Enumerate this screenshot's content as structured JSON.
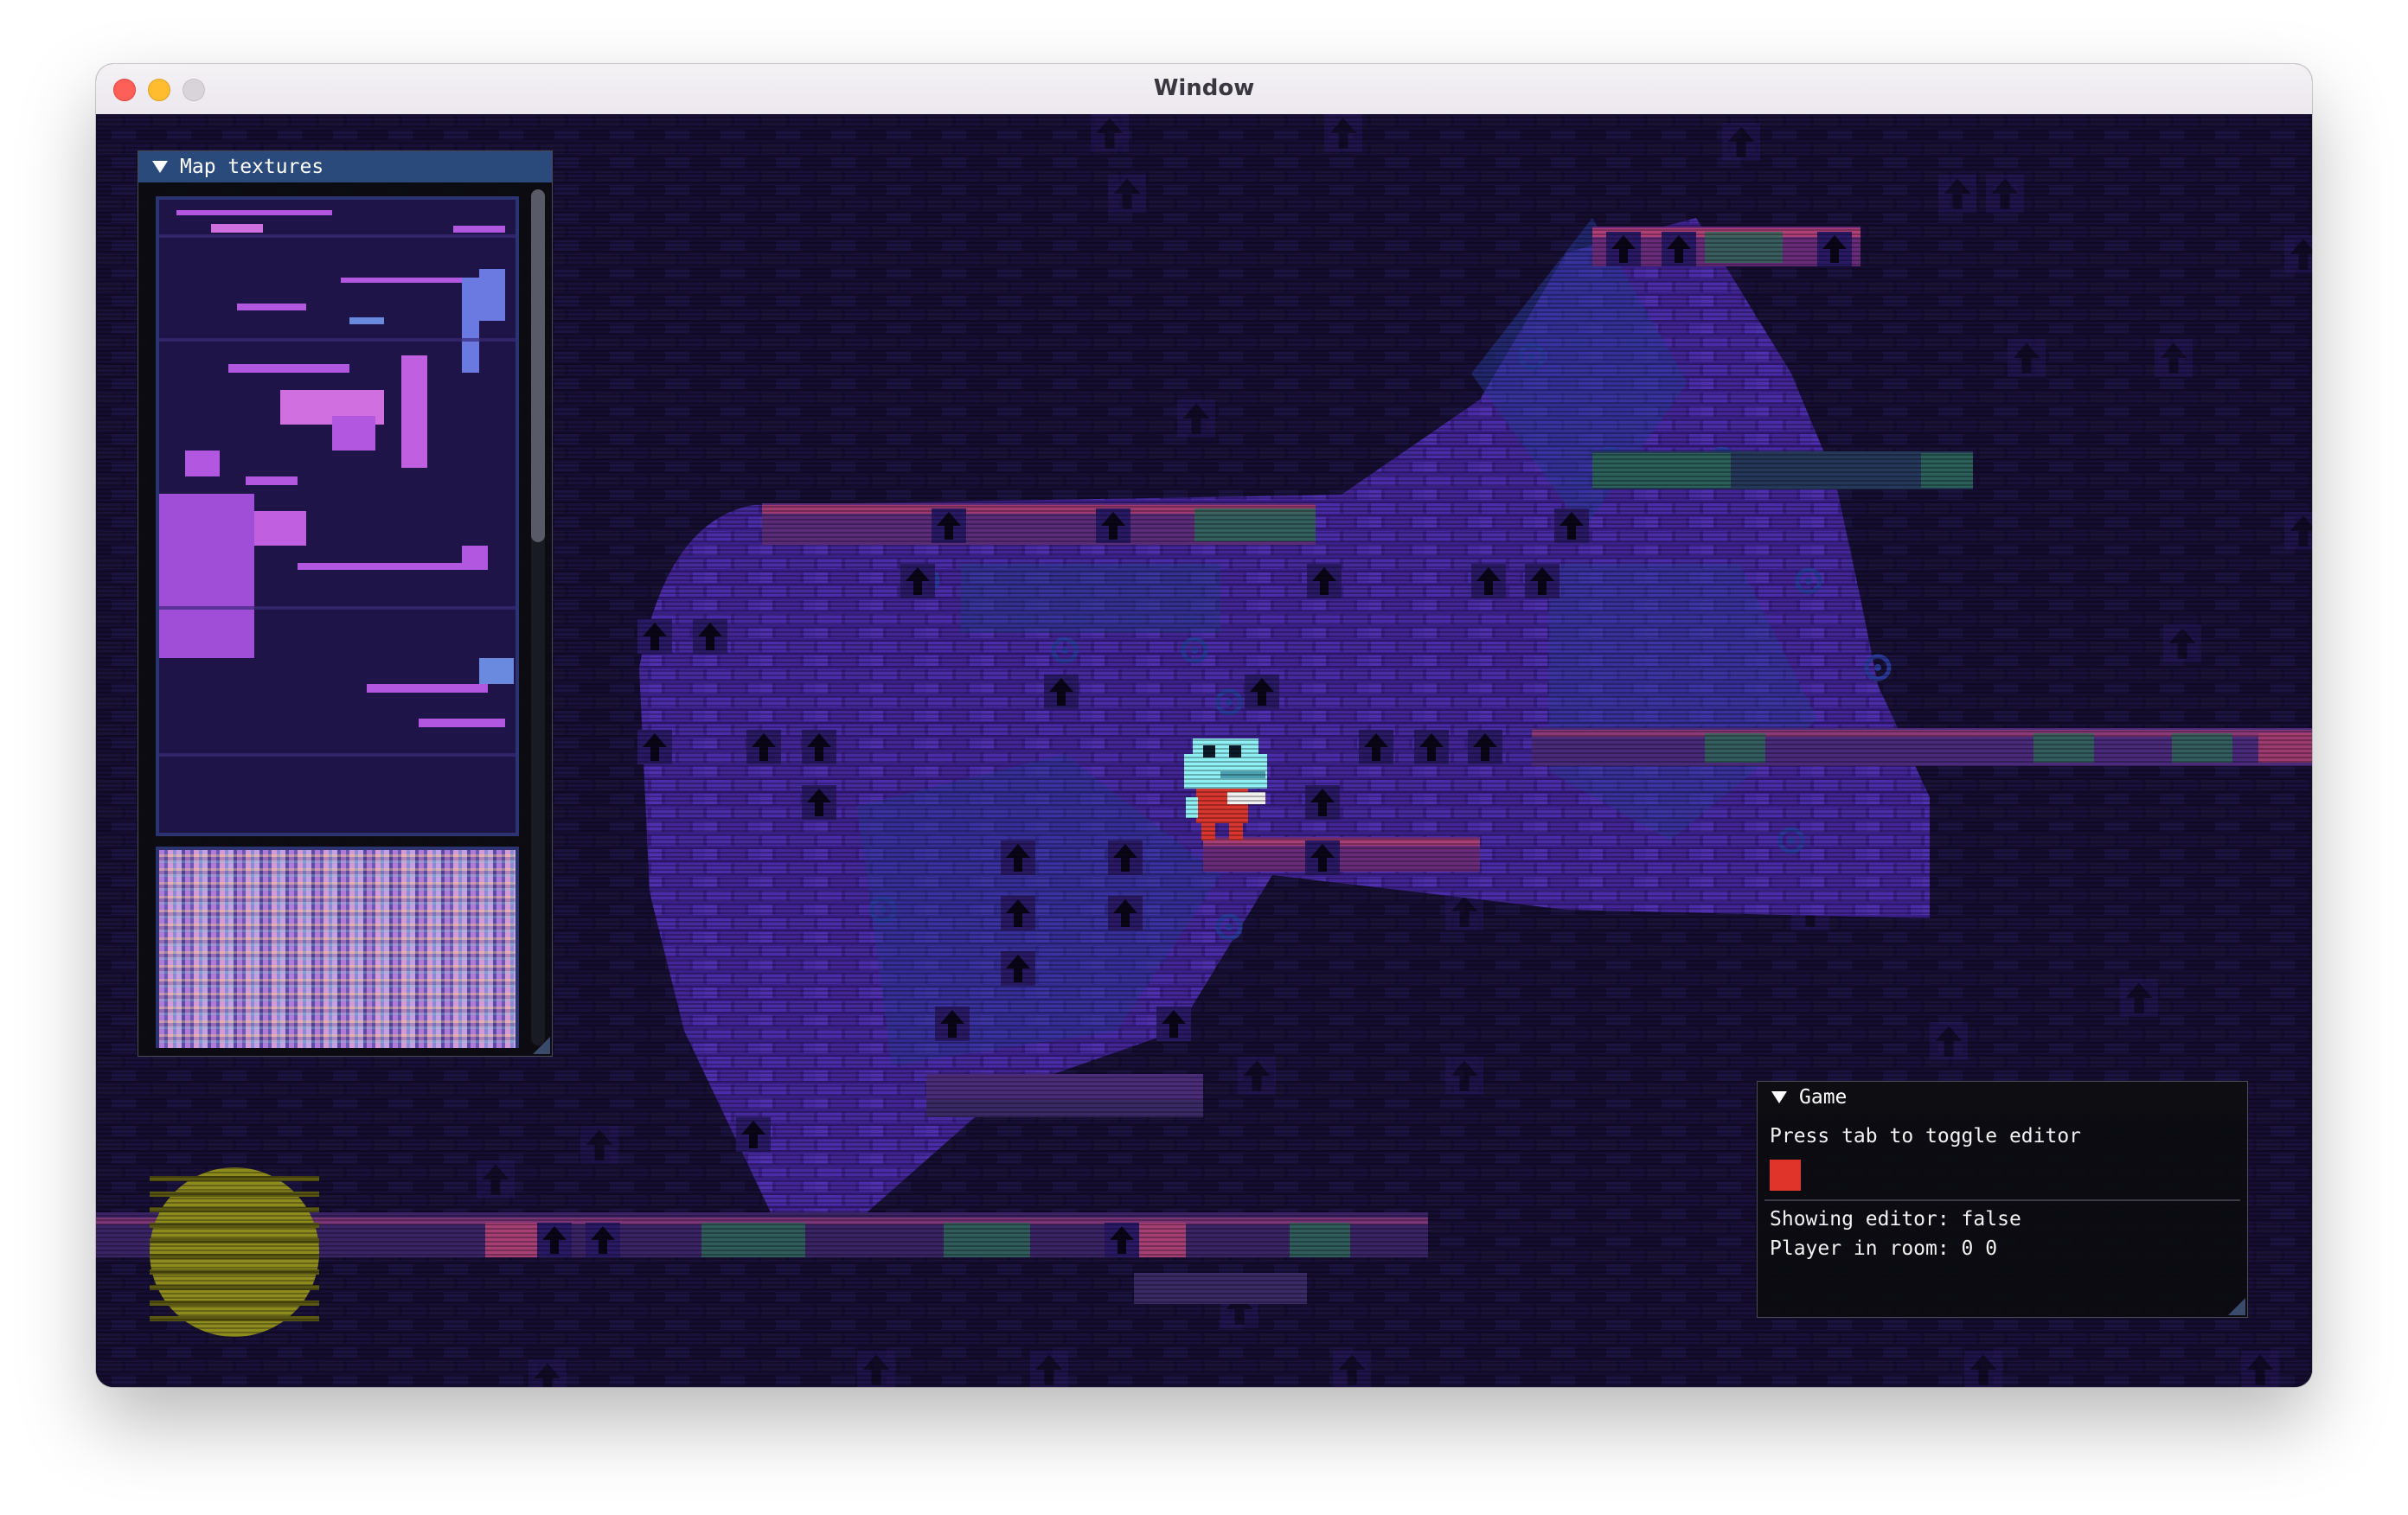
{
  "window": {
    "title": "Window"
  },
  "map_textures_panel": {
    "title": "Map textures"
  },
  "game_panel": {
    "title": "Game",
    "hint": "Press tab to toggle editor",
    "swatch_color": "#e0332a",
    "showing_editor": "Showing editor: false",
    "player_in_room": "Player in room: 0 0"
  },
  "scene": {
    "background_color": "#130d2c",
    "room_fill_color": "#3a1f88",
    "brick_color": "#4a2ca8",
    "platform_color": "#8a3a7a",
    "sun_color": "#8d8a1e",
    "player_colors": {
      "head": "#8ef0f4",
      "body": "#d8362e"
    },
    "icons": [
      "arrow-up-tile-icon",
      "gear-tile-icon",
      "sun-icon",
      "player-sprite"
    ]
  }
}
